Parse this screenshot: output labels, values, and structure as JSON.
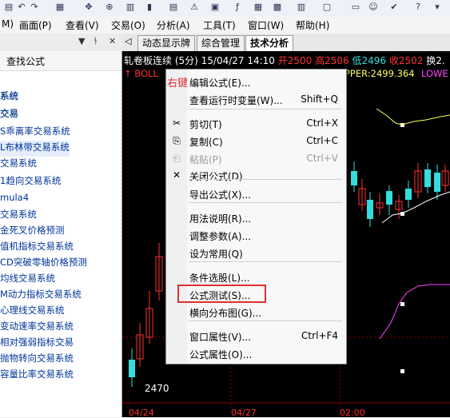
{
  "menubar": [
    "M)",
    "画面(P)",
    "查看(V)",
    "交易(O)",
    "分析(A)",
    "工具(T)",
    "窗口(W)",
    "帮助(H)"
  ],
  "left_panel": {
    "search_label": "查找公式",
    "items": [
      {
        "label": "系统",
        "bold": true
      },
      {
        "label": "交易",
        "bold": true
      },
      {
        "label": "S乖离率交易系统",
        "bold": false
      },
      {
        "label": "L布林带交易系统",
        "bold": false
      },
      {
        "label": "交易系统",
        "bold": false
      },
      {
        "label": "1趋向交易系统",
        "bold": false
      },
      {
        "label": "mula4",
        "bold": false
      },
      {
        "label": "交易系统",
        "bold": false
      },
      {
        "label": "金死叉价格预测",
        "bold": false
      },
      {
        "label": "值机指标交易系统",
        "bold": false
      },
      {
        "label": "CD突破零轴价格预测",
        "bold": false
      },
      {
        "label": "均线交易系统",
        "bold": false
      },
      {
        "label": "M动力指标交易系统",
        "bold": false
      },
      {
        "label": "心理线交易系统",
        "bold": false
      },
      {
        "label": "变动速率交易系统",
        "bold": false
      },
      {
        "label": "相对强弱指标交易",
        "bold": false
      },
      {
        "label": "抛物转向交易系统",
        "bold": false
      },
      {
        "label": "容量比率交易系统",
        "bold": false
      }
    ]
  },
  "tabs": [
    "动态显示牌",
    "综合管理",
    "技术分析"
  ],
  "chart": {
    "title_name": "轧卷板连续 (5分) 15/04/27 14:10",
    "open": "开2500",
    "high": "高2506",
    "low": "低2496",
    "close": "收2502",
    "change": "换2.",
    "indicator_left": "↑ BOLL",
    "indicator_upper": "PPER:2499.364",
    "indicator_lower": "LOWE",
    "price_label": "2470",
    "dates": [
      "04/24",
      "04/27",
      "02:00"
    ]
  },
  "context_menu": {
    "hint": "右键",
    "items": [
      {
        "label": "编辑公式(E)...",
        "shortcut": "",
        "icon": "",
        "disabled": false
      },
      {
        "label": "查看运行时变量(W)...",
        "shortcut": "Shift+Q",
        "icon": "",
        "disabled": false
      },
      {
        "label": "剪切(T)",
        "shortcut": "Ctrl+X",
        "icon": "cut-icon",
        "disabled": false
      },
      {
        "label": "复制(C)",
        "shortcut": "Ctrl+C",
        "icon": "copy-icon",
        "disabled": false
      },
      {
        "label": "粘贴(P)",
        "shortcut": "Ctrl+V",
        "icon": "paste-icon",
        "disabled": true
      },
      {
        "label": "关闭公式(D)",
        "shortcut": "",
        "icon": "close-icon",
        "disabled": false
      },
      {
        "label": "导出公式(X)...",
        "shortcut": "",
        "icon": "",
        "disabled": false
      },
      {
        "label": "用法说明(R)...",
        "shortcut": "",
        "icon": "",
        "disabled": false
      },
      {
        "label": "调整参数(A)...",
        "shortcut": "",
        "icon": "",
        "disabled": false
      },
      {
        "label": "设为常用(Q)",
        "shortcut": "",
        "icon": "",
        "disabled": false
      },
      {
        "label": "条件选股(L)...",
        "shortcut": "",
        "icon": "",
        "disabled": false
      },
      {
        "label": "公式测试(S)...",
        "shortcut": "",
        "icon": "",
        "disabled": false
      },
      {
        "label": "横向分布图(G)...",
        "shortcut": "",
        "icon": "",
        "disabled": false
      },
      {
        "label": "窗口属性(V)...",
        "shortcut": "Ctrl+F4",
        "icon": "",
        "disabled": false
      },
      {
        "label": "公式属性(O)...",
        "shortcut": "",
        "icon": "",
        "disabled": false
      }
    ]
  },
  "colors": {
    "up": "#ff3030",
    "down": "#33dddd",
    "upper_band": "#ffff66",
    "mid_band": "#ffffff",
    "lower_band": "#ff44ff"
  }
}
